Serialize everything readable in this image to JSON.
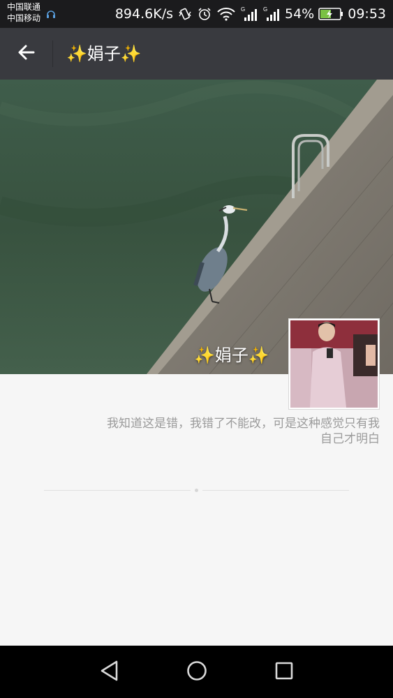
{
  "status_bar": {
    "carrier_1": "中国联通",
    "carrier_2": "中国移动",
    "network_speed": "894.6K/s",
    "battery_percent": "54%",
    "battery_level": 0.54,
    "time": "09:53",
    "icons": [
      "headset-icon",
      "vibrate-icon",
      "alarm-icon",
      "wifi-icon",
      "signal-icon",
      "signal-icon",
      "battery-icon"
    ]
  },
  "app_bar": {
    "back_icon": "arrow-left-icon",
    "title": "✨娟子✨"
  },
  "profile": {
    "cover_name": "✨娟子✨",
    "signature": "我知道这是错，我错了不能改，可是这种感觉只有我自己才明白"
  },
  "nav_bar": {
    "icons": [
      "back-triangle-icon",
      "home-circle-icon",
      "recents-square-icon"
    ]
  },
  "colors": {
    "status_bar": "#1b1b1d",
    "app_bar": "#393a3f",
    "page_background": "#f6f6f6",
    "signature_text": "#9b9b9b",
    "nav_bar": "#000000"
  }
}
